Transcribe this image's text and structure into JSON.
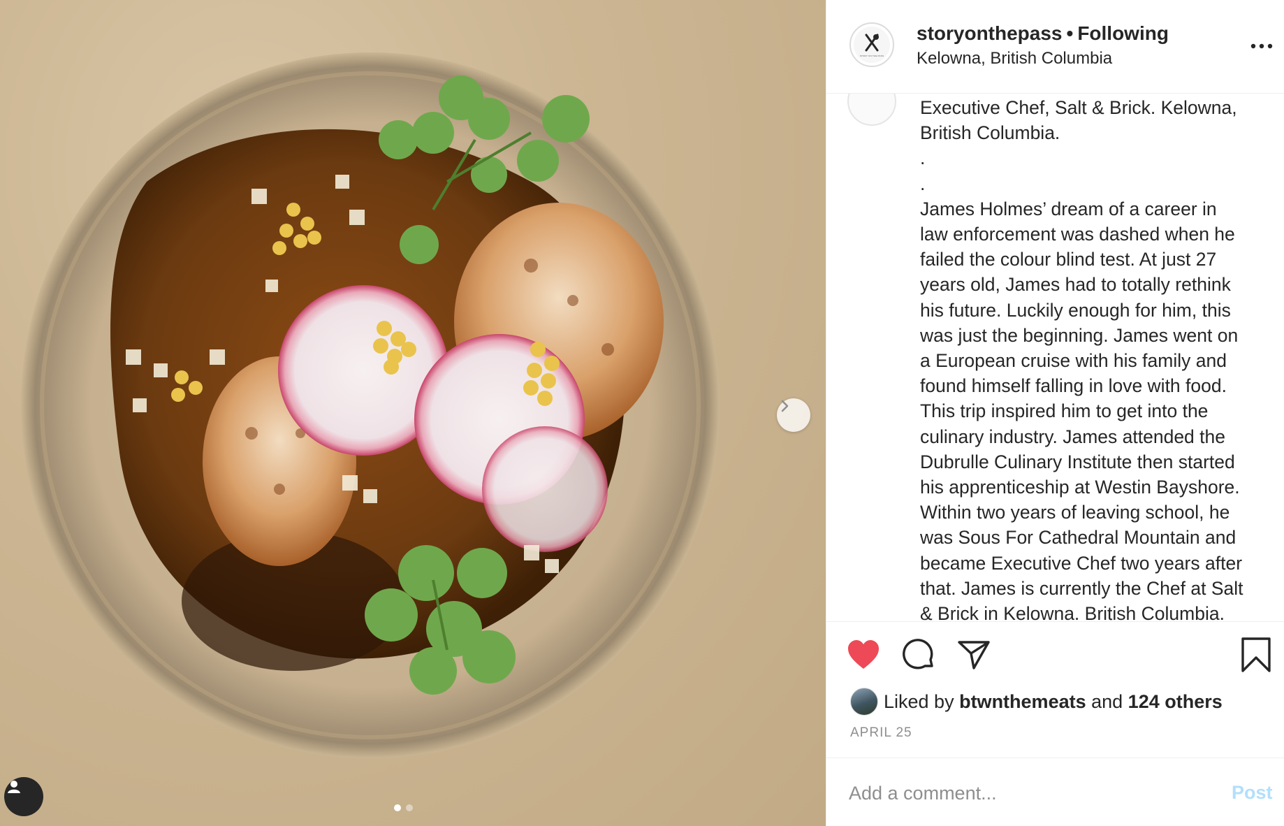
{
  "post": {
    "username": "storyonthepass",
    "separator": "•",
    "follow_status": "Following",
    "location": "Kelowna, British Columbia",
    "avatar_text": "STORY ON THE PASS",
    "more_icon": "more-horizontal-icon"
  },
  "photo": {
    "description_icon": "plated-scallop-dish-photo",
    "next_icon": "chevron-right-icon",
    "carousel": {
      "total": 2,
      "active_index": 0
    }
  },
  "caption": {
    "lines": [
      "Executive Chef, Salt & Brick. Kelowna,",
      "British Columbia.",
      ".",
      ".",
      "James Holmes’ dream of a career in",
      "law enforcement was dashed when he",
      "failed the colour blind test. At just 27",
      "years old, James had to totally rethink",
      "his future. Luckily enough for him, this",
      "was just the beginning. James went on",
      "a European cruise with his family and",
      "found himself falling in love with food.",
      "This trip inspired him to get into the",
      "culinary industry. James attended the",
      "Dubrulle Culinary Institute then started",
      "his apprenticeship at Westin Bayshore.",
      "Within two years of leaving school, he",
      "was Sous For Cathedral Mountain and",
      "became Executive Chef two years after",
      "that. James is currently the Chef at Salt",
      "& Brick in Kelowna. British Columbia."
    ]
  },
  "actions": {
    "like_icon": "heart-filled-icon",
    "comment_icon": "comment-bubble-icon",
    "share_icon": "paper-plane-icon",
    "save_icon": "bookmark-icon",
    "liked": true
  },
  "likes": {
    "prefix": "Liked by ",
    "first_user": "btwnthemeats",
    "connector": " and ",
    "others": "124 others"
  },
  "date": "APRIL 25",
  "comment": {
    "placeholder": "Add a comment...",
    "post_label": "Post"
  },
  "colors": {
    "like_red": "#ed4956",
    "post_disabled_blue": "#b2dffc",
    "muted_gray": "#8e8e8e",
    "text": "#262626"
  }
}
